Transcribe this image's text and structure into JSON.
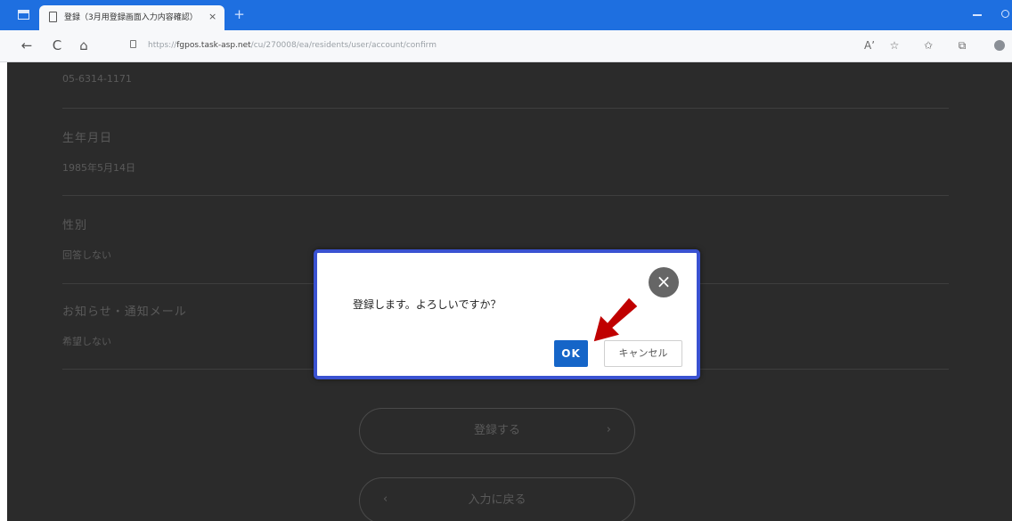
{
  "browser": {
    "tab_title": "登録（3月用登録画面入力内容確認）",
    "tab_close": "×",
    "new_tab": "+",
    "url_prefix": "https://",
    "url_host": "fgpos.task-asp.net",
    "url_path": "/cu/270008/ea/residents/user/account/confirm",
    "nav": {
      "back": "←",
      "reload": "C",
      "home": "⌂"
    },
    "toolbar_icons": [
      "read-aloud-icon",
      "favorite-add-icon",
      "favorites-icon",
      "collections-icon",
      "profile-icon"
    ]
  },
  "page": {
    "fields": [
      {
        "label": "",
        "value": "05-6314-1171"
      },
      {
        "label": "生年月日",
        "value": "1985年5月14日"
      },
      {
        "label": "性別",
        "value": "回答しない"
      },
      {
        "label": "お知らせ・通知メール",
        "value": "希望しない"
      }
    ],
    "register_button": "登録する",
    "register_chevron": "›",
    "back_button": "入力に戻る",
    "back_chevron": "‹"
  },
  "modal": {
    "message": "登録します。よろしいですか？",
    "ok_label": "OK",
    "cancel_label": "キャンセル",
    "close_label": "×"
  },
  "colors": {
    "titlebar": "#1e6fe0",
    "overlay": "#2b2b2b",
    "modal_border": "#3a52d1",
    "ok_button": "#1565c8",
    "annotation_arrow": "#c00000"
  }
}
